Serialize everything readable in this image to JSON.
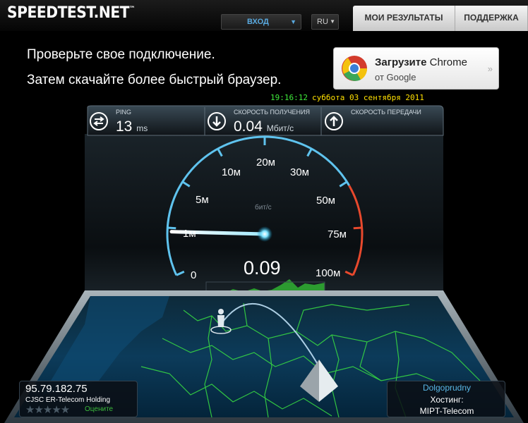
{
  "header": {
    "logo": "SPEEDTEST.NET",
    "logo_tm": "™",
    "login_label": "ВХОД",
    "language": "RU",
    "tabs": [
      {
        "label": "МОИ РЕЗУЛЬТАТЫ"
      },
      {
        "label": "ПОДДЕРЖКА"
      }
    ]
  },
  "promo": {
    "line1": "Проверьте свое подключение.",
    "line2": "Затем скачайте более быстрый браузер."
  },
  "chrome_ad": {
    "title_bold": "Загрузите",
    "title_rest": " Chrome",
    "subtitle": "от Google",
    "arrow": "»"
  },
  "clock": {
    "time": "19:16:12",
    "date": "суббота 03 сентября 2011"
  },
  "stats": {
    "ping": {
      "label": "PING",
      "value": "13",
      "unit": "ms",
      "icon": "ping-arrows-icon"
    },
    "download": {
      "label": "СКОРОСТЬ ПОЛУЧЕНИЯ",
      "value": "0.04",
      "unit": "Мбит/с",
      "icon": "download-arrow-icon"
    },
    "upload": {
      "label": "СКОРОСТЬ ПЕРЕДАЧИ",
      "value": "",
      "unit": "",
      "icon": "upload-arrow-icon"
    }
  },
  "gauge": {
    "labels": [
      "0",
      "1м",
      "5м",
      "10м",
      "20м",
      "30м",
      "50м",
      "75м",
      "100м"
    ],
    "unit": "бит/с",
    "value": "0.09",
    "needle_position": 0.115
  },
  "client": {
    "ip": "95.79.182.75",
    "isp": "CJSC ER-Telecom Holding",
    "stars": "★★★★★",
    "rating": 0,
    "rate_label": "Оцените"
  },
  "server": {
    "city": "Dolgoprudny",
    "host_label": "Хостинг:",
    "host": "MIPT-Telecom"
  },
  "colors": {
    "accent_blue": "#59b7e6",
    "gauge_red": "#e8492d",
    "graph_green": "#2fa832"
  }
}
